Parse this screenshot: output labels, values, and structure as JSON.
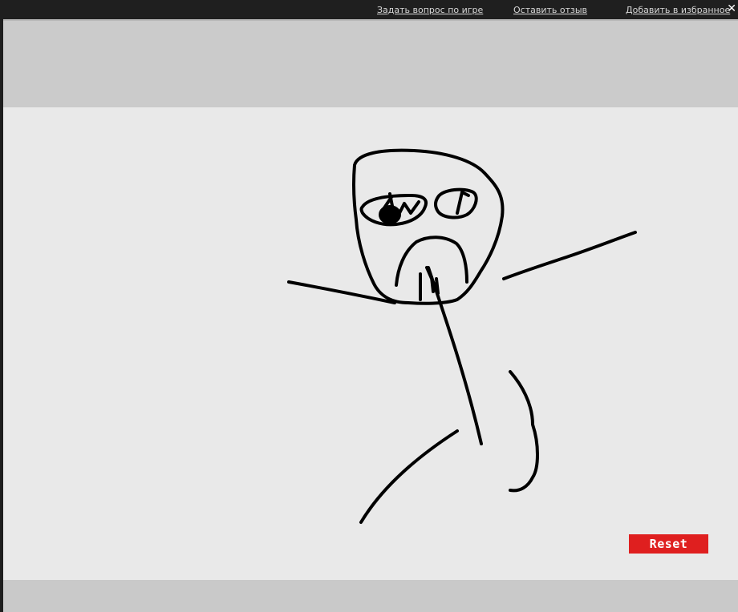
{
  "top_links": {
    "ask_question": "Задать вопрос по игре",
    "leave_review": "Оставить отзыв",
    "add_favorite": "Добавить в избранное"
  },
  "close_symbol": "✕",
  "game": {
    "reset_label": "Reset",
    "colors": {
      "reset_button": "#df1f1f",
      "canvas_bg": "#e9e9e9",
      "stroke": "#000000"
    }
  }
}
